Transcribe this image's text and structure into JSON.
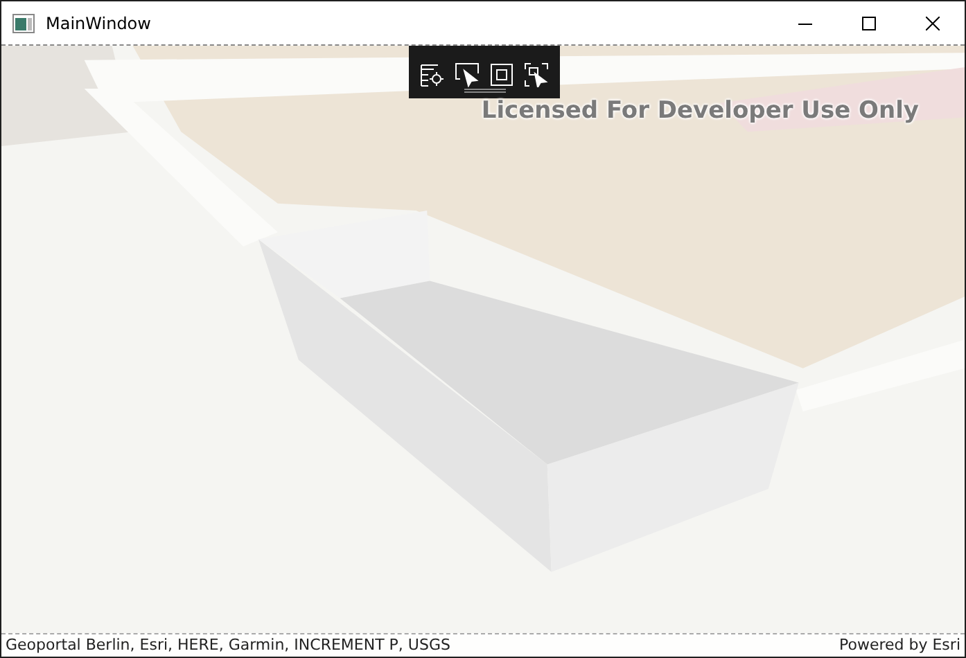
{
  "window": {
    "title": "MainWindow"
  },
  "map": {
    "watermark": "Licensed For Developer Use Only",
    "attribution": "Geoportal Berlin, Esri, HERE, Garmin, INCREMENT P, USGS",
    "powered_by": "Powered by Esri"
  }
}
